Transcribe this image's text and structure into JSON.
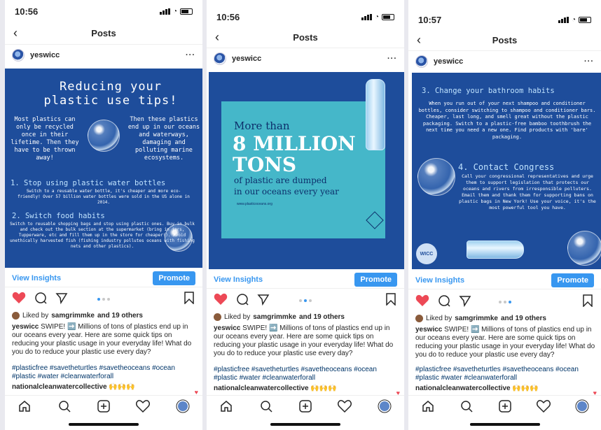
{
  "screens": [
    {
      "time": "10:56",
      "nav_title": "Posts",
      "username": "yeswicc",
      "slide": {
        "title": "Reducing your plastic use tips!",
        "left_text": "Most plastics can only be recycled once in their lifetime. Then they have to be thrown away!",
        "right_text": "Then these plastics end up in our oceans and waterways, damaging and polluting marine ecosystems.",
        "h1": "1. Stop using plastic water bottles",
        "p1": "Switch to a reusable water bottle, it's cheaper and more eco-friendly! Over 57 billion water bottles were sold in the US alone in 2014.",
        "h2": "2. Switch food habits",
        "p2": "Switch to reusable shopping bags and stop using plastic ones. Buy in bulk and check out the bulk section at the supermarket (bring in jars, Tupperware, etc and fill them up in the store for cheaper!). Avoid unethically harvested fish (fishing industry pollutes oceans with fishing nets and other plastics)."
      },
      "dot_active": 0
    },
    {
      "time": "10:56",
      "nav_title": "Posts",
      "username": "yeswicc",
      "slide": {
        "line1": "More than",
        "line2": "8 MILLION",
        "line3": "TONS",
        "line4": "of plastic are dumped",
        "line5": "in our oceans every year",
        "source": "www.plasticoceans.org"
      },
      "dot_active": 1
    },
    {
      "time": "10:57",
      "nav_title": "Posts",
      "username": "yeswicc",
      "slide": {
        "h3": "3. Change your bathroom habits",
        "p3": "When you run out of your next shampoo and conditioner bottles, consider switching to shampoo and conditioner bars. Cheaper, last long, and smell great without the plastic packaging. Switch to a plastic-free bamboo toothbrush the next time you need a new one. Find products with 'bare' packaging.",
        "h4": "4. Contact Congress",
        "p4": "Call your congressional representatives and urge them to support legislation that protects our oceans and rivers from irresponsible polluters. Email them and thank them for supporting bans on plastic bags in New York! Use your voice, it's the most powerful tool you have.",
        "logo": "WICC"
      },
      "dot_active": 2
    }
  ],
  "common": {
    "view_insights": "View Insights",
    "promote": "Promote",
    "liked_by_prefix": "Liked by",
    "liked_by_user": "samgrimmke",
    "liked_by_suffix": "and 19 others",
    "caption_user": "yeswicc",
    "caption_text": "SWIPE! ➡️ Millions of tons of plastics end up in our oceans every year. Here are some quick tips on reducing your plastic usage in your everyday life! What do you do to reduce your plastic use every day?",
    "hashtags": "#plasticfree #savetheturtles #savetheoceans #ocean #plastic #water #cleanwaterforall",
    "comment_user": "nationalcleanwatercollective",
    "comment_emoji": "🙌🙌🙌"
  },
  "colors": {
    "post_blue": "#1e4d9b",
    "teal_box": "#45b7c9",
    "accent_blue": "#3897f0",
    "like_red": "#ed4956"
  },
  "icons": [
    "heart-icon",
    "comment-icon",
    "share-icon",
    "bookmark-icon",
    "home-icon",
    "search-icon",
    "new-post-icon",
    "activity-icon",
    "profile-icon",
    "back-icon",
    "more-icon"
  ]
}
